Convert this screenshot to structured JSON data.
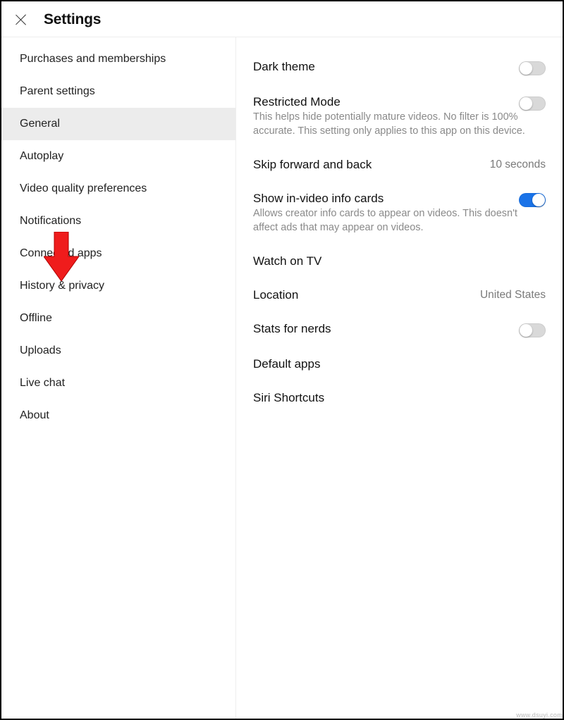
{
  "header": {
    "title": "Settings"
  },
  "sidebar": {
    "items": [
      {
        "label": "Purchases and memberships",
        "selected": false
      },
      {
        "label": "Parent settings",
        "selected": false
      },
      {
        "label": "General",
        "selected": true
      },
      {
        "label": "Autoplay",
        "selected": false
      },
      {
        "label": "Video quality preferences",
        "selected": false
      },
      {
        "label": "Notifications",
        "selected": false
      },
      {
        "label": "Connected apps",
        "selected": false
      },
      {
        "label": "History & privacy",
        "selected": false
      },
      {
        "label": "Offline",
        "selected": false
      },
      {
        "label": "Uploads",
        "selected": false
      },
      {
        "label": "Live chat",
        "selected": false
      },
      {
        "label": "About",
        "selected": false
      }
    ]
  },
  "content": {
    "dark_theme": {
      "label": "Dark theme",
      "on": false
    },
    "restricted_mode": {
      "label": "Restricted Mode",
      "on": false,
      "desc": "This helps hide potentially mature videos. No filter is 100% accurate. This setting only applies to this app on this device."
    },
    "skip": {
      "label": "Skip forward and back",
      "value": "10 seconds"
    },
    "info_cards": {
      "label": "Show in-video info cards",
      "on": true,
      "desc": "Allows creator info cards to appear on videos. This doesn't affect ads that may appear on videos."
    },
    "watch_tv": {
      "label": "Watch on TV"
    },
    "location": {
      "label": "Location",
      "value": "United States"
    },
    "stats": {
      "label": "Stats for nerds",
      "on": false
    },
    "default_apps": {
      "label": "Default apps"
    },
    "siri": {
      "label": "Siri Shortcuts"
    }
  },
  "watermark": "www.dsuyi.com"
}
